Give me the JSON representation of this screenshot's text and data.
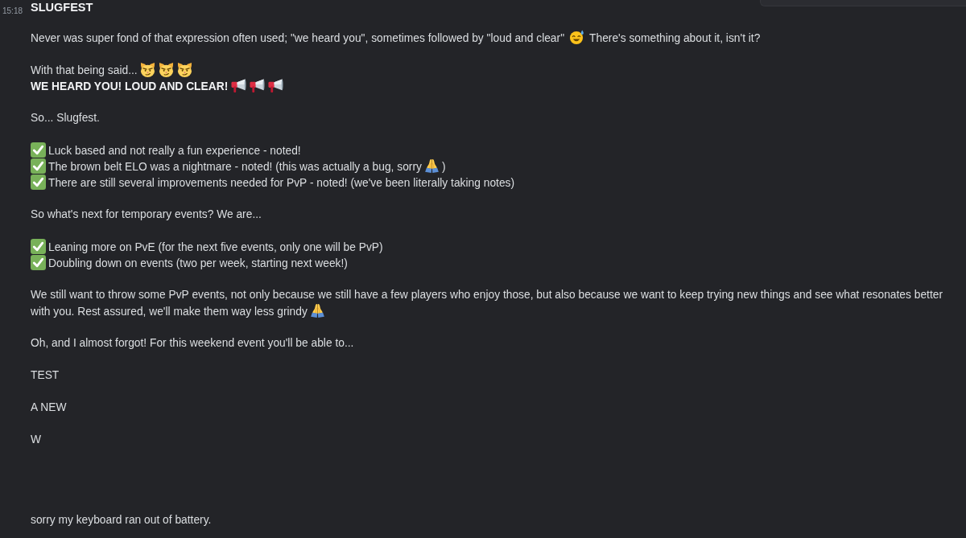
{
  "message": {
    "time": "15:18",
    "author": "SLUGFEST",
    "paragraphs": [
      {
        "lines": [
          {
            "parts": [
              {
                "kind": "text",
                "text": "Never was super fond of that expression often used; \"we heard you\", sometimes followed by \"loud and clear\""
              },
              {
                "kind": "sweat"
              },
              {
                "kind": "text",
                "text": "There's something about it, isn't it?"
              }
            ]
          }
        ]
      },
      {
        "lines": [
          {
            "parts": [
              {
                "kind": "text",
                "text": "With that being said..."
              },
              {
                "kind": "cat"
              },
              {
                "kind": "cat"
              },
              {
                "kind": "cat"
              }
            ]
          },
          {
            "parts": [
              {
                "kind": "bold",
                "text": "WE HEARD YOU! LOUD AND CLEAR!"
              },
              {
                "kind": "megaphone"
              },
              {
                "kind": "megaphone"
              },
              {
                "kind": "megaphone"
              }
            ]
          }
        ]
      },
      {
        "lines": [
          {
            "parts": [
              {
                "kind": "text",
                "text": "So... Slugfest."
              }
            ]
          }
        ]
      },
      {
        "lines": [
          {
            "parts": [
              {
                "kind": "check"
              },
              {
                "kind": "text",
                "text": "Luck based and not really a fun experience - noted!"
              }
            ]
          },
          {
            "parts": [
              {
                "kind": "check"
              },
              {
                "kind": "text",
                "text": "The brown belt ELO was a nightmare - noted! (this was actually a bug, sorry"
              },
              {
                "kind": "pray"
              },
              {
                "kind": "text",
                "text": ")"
              }
            ]
          },
          {
            "parts": [
              {
                "kind": "check"
              },
              {
                "kind": "text",
                "text": "There are still several improvements needed for PvP - noted! (we've been literally taking notes)"
              }
            ]
          }
        ]
      },
      {
        "lines": [
          {
            "parts": [
              {
                "kind": "text",
                "text": "So what's next for temporary events? We are..."
              }
            ]
          }
        ]
      },
      {
        "lines": [
          {
            "parts": [
              {
                "kind": "check"
              },
              {
                "kind": "text",
                "text": "Leaning more on PvE (for the next five events, only one will be PvP)"
              }
            ]
          },
          {
            "parts": [
              {
                "kind": "check"
              },
              {
                "kind": "text",
                "text": "Doubling down on events (two per week, starting next week!)"
              }
            ]
          }
        ]
      },
      {
        "lines": [
          {
            "parts": [
              {
                "kind": "text",
                "text": "We still want to throw some PvP events, not only because we still have a few players who enjoy those, but also because we want to keep trying new things and see what resonates better"
              }
            ]
          },
          {
            "parts": [
              {
                "kind": "text",
                "text": "with you. Rest assured, we'll make them way less grindy"
              },
              {
                "kind": "pray"
              }
            ]
          }
        ]
      },
      {
        "lines": [
          {
            "parts": [
              {
                "kind": "text",
                "text": "Oh, and I almost forgot! For this weekend event you'll be able to..."
              }
            ]
          }
        ]
      },
      {
        "lines": [
          {
            "parts": [
              {
                "kind": "text",
                "text": "TEST"
              }
            ]
          }
        ]
      },
      {
        "lines": [
          {
            "parts": [
              {
                "kind": "text",
                "text": "A NEW"
              }
            ]
          }
        ]
      },
      {
        "lines": [
          {
            "parts": [
              {
                "kind": "text",
                "text": "W"
              }
            ]
          }
        ]
      },
      {
        "lines": [
          {
            "parts": [
              {
                "kind": "text",
                "text": "sorry my keyboard ran out of battery."
              }
            ]
          }
        ]
      }
    ]
  }
}
